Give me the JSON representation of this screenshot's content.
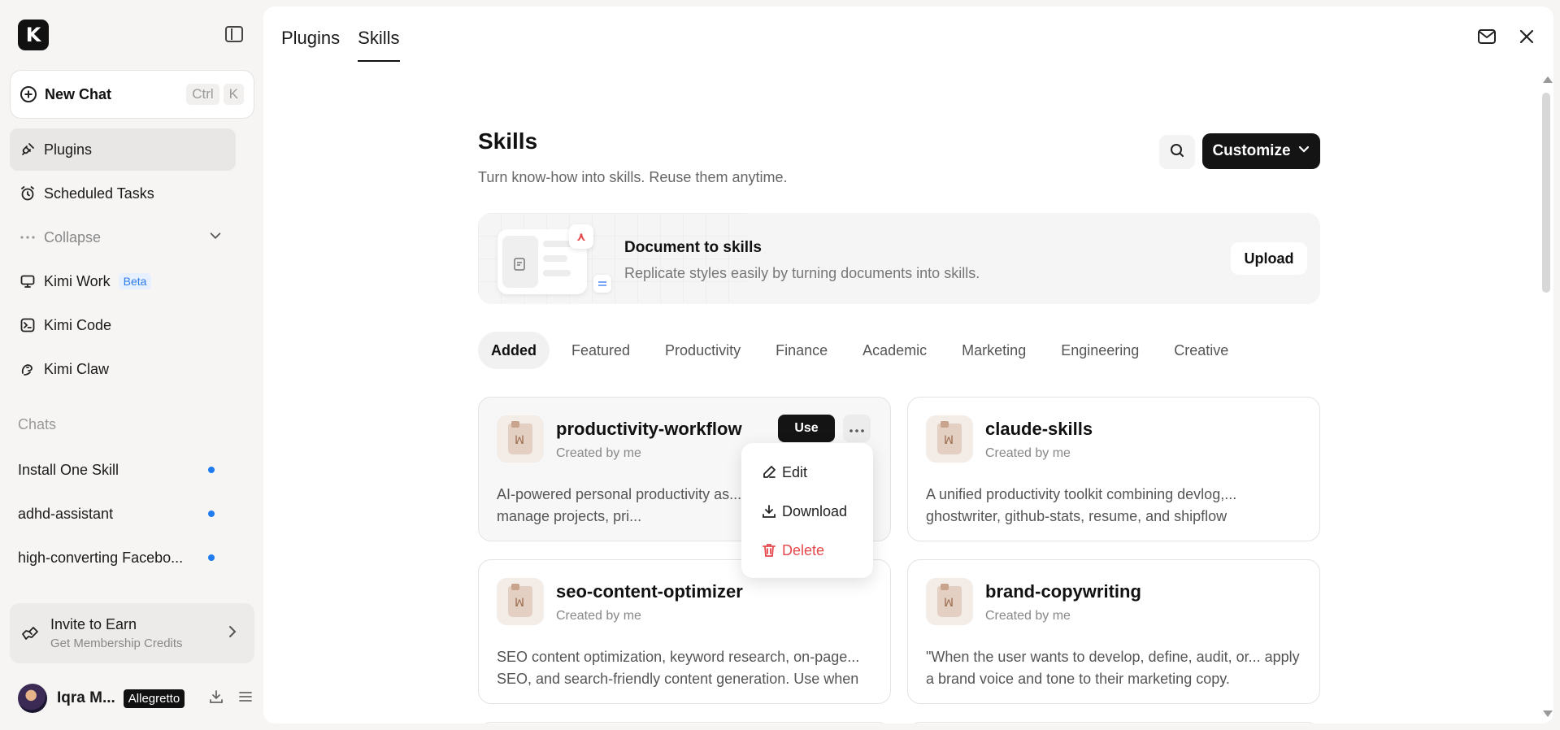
{
  "app": {
    "logo": "K"
  },
  "sidebar": {
    "new_chat": {
      "label": "New Chat",
      "shortcut": [
        "Ctrl",
        "K"
      ]
    },
    "nav": [
      {
        "label": "Plugins",
        "icon": "plug-icon",
        "active": true
      },
      {
        "label": "Scheduled Tasks",
        "icon": "alarm-clock-icon"
      },
      {
        "label": "Collapse",
        "icon": "more-dots-icon"
      },
      {
        "label": "Kimi Work",
        "icon": "monitor-icon",
        "badge": "Beta"
      },
      {
        "label": "Kimi Code",
        "icon": "terminal-icon"
      },
      {
        "label": "Kimi Claw",
        "icon": "claw-icon"
      }
    ],
    "chats_label": "Chats",
    "chats": [
      {
        "title": "Install One Skill",
        "unread": true
      },
      {
        "title": "adhd-assistant",
        "unread": true
      },
      {
        "title": "high-converting Facebo...",
        "unread": true
      }
    ],
    "invite": {
      "title": "Invite to Earn",
      "subtitle": "Get Membership Credits"
    },
    "user": {
      "name": "Iqra M...",
      "plan": "Allegretto"
    }
  },
  "header": {
    "tabs": [
      {
        "label": "Plugins"
      },
      {
        "label": "Skills",
        "active": true
      }
    ]
  },
  "skills": {
    "title": "Skills",
    "subtitle": "Turn know-how into skills. Reuse them anytime.",
    "customize_label": "Customize",
    "banner": {
      "title": "Document to skills",
      "subtitle": "Replicate styles easily by turning documents into skills.",
      "upload_label": "Upload"
    },
    "categories": [
      "Added",
      "Featured",
      "Productivity",
      "Finance",
      "Academic",
      "Marketing",
      "Engineering",
      "Creative"
    ],
    "active_category": "Added",
    "cards": [
      {
        "name": "productivity-workflow",
        "by": "Created by me",
        "desc": "AI-powered personal productivity as... organize tasks, manage projects, pri...",
        "use_label": "Use"
      },
      {
        "name": "claude-skills",
        "by": "Created by me",
        "desc": "A unified productivity toolkit combining devlog,... ghostwriter, github-stats, resume, and shipflow"
      },
      {
        "name": "seo-content-optimizer",
        "by": "Created by me",
        "desc": "SEO content optimization, keyword research, on-page... SEO, and search-friendly content generation. Use when"
      },
      {
        "name": "brand-copywriting",
        "by": "Created by me",
        "desc": "\"When the user wants to develop, define, audit, or... apply a brand voice and tone to their marketing copy."
      }
    ],
    "context_menu": {
      "edit": "Edit",
      "download": "Download",
      "delete": "Delete"
    }
  },
  "colors": {
    "accent": "#141414",
    "unread_dot": "#1f7cf0",
    "danger": "#e5484d",
    "beta": "#2f7be8"
  }
}
